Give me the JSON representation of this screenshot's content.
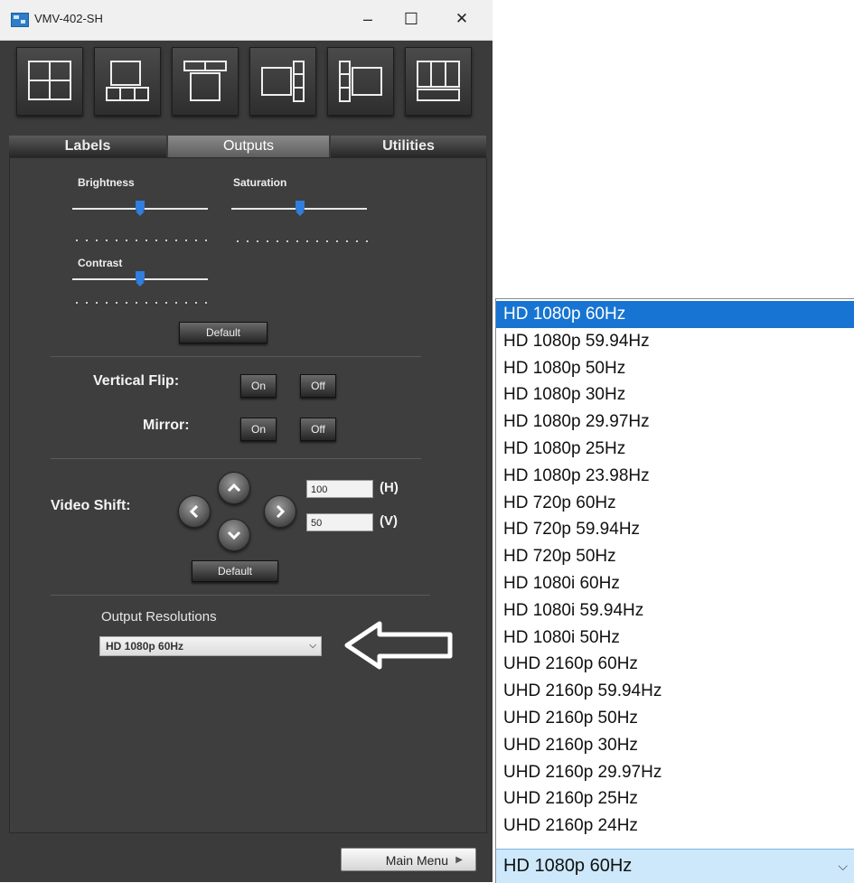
{
  "window": {
    "title": "VMV-402-SH",
    "controls": {
      "minimize": "–",
      "maximize": "☐",
      "close": "✕"
    }
  },
  "layout_buttons": [
    "quad-layout-icon",
    "picture-bottom-three-icon",
    "picture-top-two-icon",
    "main-right-stack-icon",
    "left-stack-main-icon",
    "top-three-bottom-icon"
  ],
  "tabs": [
    {
      "label": "Labels",
      "active": false
    },
    {
      "label": "Outputs",
      "active": true
    },
    {
      "label": "Utilities",
      "active": false
    }
  ],
  "sliders": {
    "brightness": {
      "label": "Brightness",
      "value": 0.5
    },
    "saturation": {
      "label": "Saturation",
      "value": 0.5
    },
    "contrast": {
      "label": "Contrast",
      "value": 0.5
    }
  },
  "default_label": "Default",
  "vertical_flip": {
    "label": "Vertical Flip:",
    "on": "On",
    "off": "Off"
  },
  "mirror": {
    "label": "Mirror:",
    "on": "On",
    "off": "Off"
  },
  "video_shift": {
    "label": "Video Shift:",
    "h_value": "100",
    "h_unit": "(H)",
    "v_value": "50",
    "v_unit": "(V)",
    "default_label": "Default"
  },
  "output_resolutions": {
    "label": "Output Resolutions",
    "selected": "HD 1080p 60Hz"
  },
  "main_menu": {
    "label": "Main Menu",
    "chevron": "▶"
  },
  "dropdown": {
    "options": [
      "HD 1080p 60Hz",
      "HD 1080p 59.94Hz",
      "HD 1080p 50Hz",
      "HD 1080p 30Hz",
      "HD 1080p 29.97Hz",
      "HD 1080p 25Hz",
      "HD 1080p 23.98Hz",
      "HD 720p 60Hz",
      "HD 720p 59.94Hz",
      "HD 720p 50Hz",
      "HD 1080i 60Hz",
      "HD 1080i 59.94Hz",
      "HD 1080i 50Hz",
      "UHD 2160p  60Hz",
      "UHD 2160p  59.94Hz",
      "UHD 2160p  50Hz",
      "UHD 2160p  30Hz",
      "UHD 2160p  29.97Hz",
      "UHD 2160p  25Hz",
      "UHD 2160p  24Hz"
    ],
    "selected_index": 0,
    "current": "HD 1080p 60Hz",
    "chevron": "⌵"
  },
  "colors": {
    "accent": "#1874d2",
    "panel": "#3e3e3e",
    "slider_thumb": "#2f7ee0"
  }
}
